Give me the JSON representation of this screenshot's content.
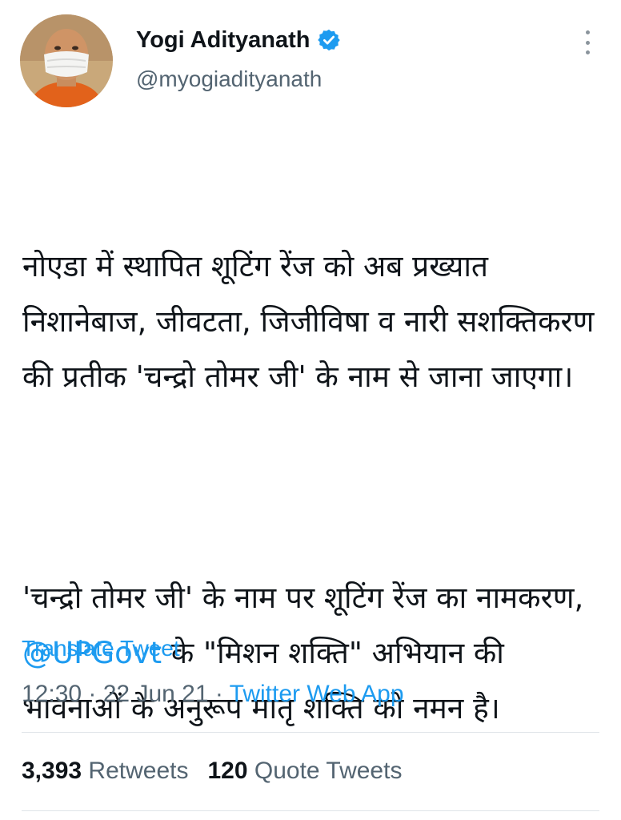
{
  "user": {
    "display_name": "Yogi Adityanath",
    "handle": "@myogiadityanath",
    "verified": true
  },
  "tweet": {
    "para1": "नोएडा में स्थापित शूटिंग रेंज को अब प्रख्यात निशानेबाज, जीवटता, जिजीविषा व नारी सशक्तिकरण की प्रतीक 'चन्द्रो तोमर जी' के नाम से जाना जाएगा।",
    "para2_before": "'चन्द्रो तोमर जी' के नाम पर शूटिंग रेंज का नामकरण, ",
    "para2_mention": "@UPGovt",
    "para2_after": " के \"मिशन शक्ति\" अभियान की भावनाओं के अनुरूप मातृ शक्ति को नमन है।"
  },
  "translate_label": "Translate Tweet",
  "meta": {
    "time": "12:30",
    "separator": " · ",
    "date": "22 Jun 21",
    "source": "Twitter Web App"
  },
  "stats": {
    "retweets_count": "3,393",
    "retweets_label": "Retweets",
    "quotes_count": "120",
    "quotes_label": "Quote Tweets"
  },
  "colors": {
    "accent": "#1d9bf0",
    "text": "#0f1419",
    "secondary": "#536471"
  },
  "icons": [
    "verified-badge-icon",
    "more-options-icon"
  ]
}
